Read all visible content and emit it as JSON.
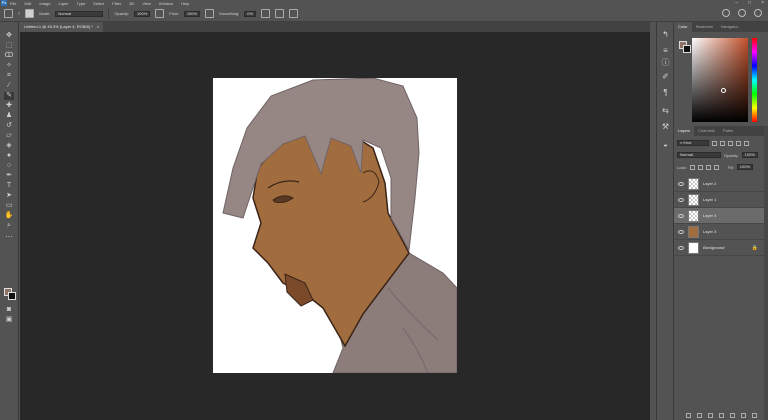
{
  "menubar": {
    "items": [
      "File",
      "Edit",
      "Image",
      "Layer",
      "Type",
      "Select",
      "Filter",
      "3D",
      "View",
      "Window",
      "Help"
    ]
  },
  "options": {
    "mode_label": "Mode:",
    "mode_value": "Normal",
    "opacity_label": "Opacity:",
    "opacity_value": "100%",
    "flow_label": "Flow:",
    "flow_value": "100%",
    "smoothing_label": "Smoothing:",
    "smoothing_value": "0%",
    "brush_size": "7"
  },
  "document": {
    "tab_title": "Untitled-1 @ 49.3% (Layer 4, RGB/8) *",
    "close_glyph": "×"
  },
  "color_panel": {
    "tabs": [
      "Color",
      "Swatches",
      "Navigator"
    ],
    "foreground": "#8c7268",
    "background": "#111111"
  },
  "layers_panel": {
    "tabs": [
      "Layers",
      "Channels",
      "Paths"
    ],
    "filter_label": "Kind",
    "blend_mode": "Normal",
    "opacity_label": "Opacity:",
    "opacity_value": "100%",
    "lock_label": "Lock:",
    "fill_label": "Fill:",
    "fill_value": "100%",
    "layers": [
      {
        "name": "Layer 2",
        "thumb": "transparent",
        "selected": false
      },
      {
        "name": "Layer 1",
        "thumb": "transparent",
        "selected": false
      },
      {
        "name": "Layer 4",
        "thumb": "transparent",
        "selected": true
      },
      {
        "name": "Layer 3",
        "thumb": "face",
        "selected": false
      },
      {
        "name": "Background",
        "thumb": "white",
        "selected": false,
        "locked": true
      }
    ]
  }
}
